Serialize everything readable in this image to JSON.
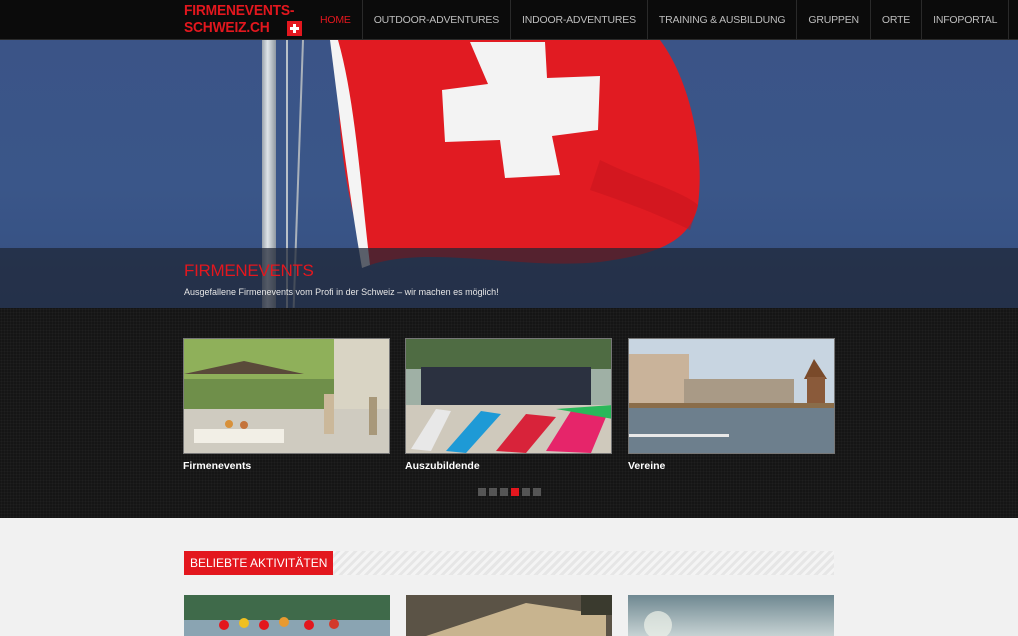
{
  "logo": {
    "line1": "FIRMENEVENTS-",
    "line2": "SCHWEIZ.CH"
  },
  "nav": [
    {
      "label": "Home",
      "active": true
    },
    {
      "label": "Outdoor-Adventures",
      "active": false
    },
    {
      "label": "Indoor-Adventures",
      "active": false
    },
    {
      "label": "Training & Ausbildung",
      "active": false
    },
    {
      "label": "Gruppen",
      "active": false
    },
    {
      "label": "Orte",
      "active": false
    },
    {
      "label": "Infoportal",
      "active": false
    }
  ],
  "hero": {
    "title": "FIRMENEVENTS",
    "subtitle": "Ausgefallene Firmenevents vom Profi in der Schweiz – wir machen es möglich!"
  },
  "slider": {
    "cards": [
      {
        "label": "Firmenevents"
      },
      {
        "label": "Auszubildende"
      },
      {
        "label": "Vereine"
      }
    ],
    "dots": 6,
    "active_dot": 3
  },
  "section": {
    "heading": "Beliebte Aktivitäten"
  },
  "colors": {
    "accent": "#e3171e",
    "nav_bg": "#0b0b0b",
    "band_bg": "#151515",
    "lower_bg": "#f1f1f1"
  }
}
